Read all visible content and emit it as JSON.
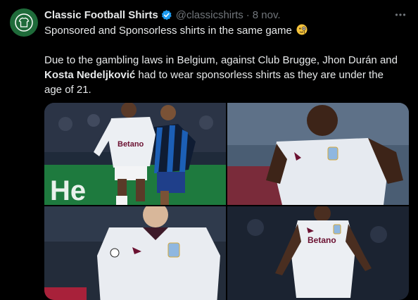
{
  "tweet": {
    "author_name": "Classic Football Shirts",
    "handle": "@classicshirts",
    "separator": "·",
    "date": "8 nov.",
    "text_line1": "Sponsored and Sponsorless shirts in the same game",
    "emoji": "face-with-monocle-emoji",
    "text_line2": "Due to the gambling laws in Belgium, against Club Brugge, Jhon Durán and",
    "text_line3_bold": "Kosta Nedeljković",
    "text_line3_rest": " had to wear sponsorless shirts as they are under the",
    "text_line4": "age of 21."
  },
  "media": {
    "photos": [
      {
        "alt": "player-sponsored-shirt-with-opponent",
        "sponsor": "Betano"
      },
      {
        "alt": "player-sponsorless-shirt",
        "sponsor": ""
      },
      {
        "alt": "player-sponsorless-shirt-2",
        "sponsor": ""
      },
      {
        "alt": "player-sponsored-shirt-2",
        "sponsor": "Betano"
      }
    ],
    "banner_text": "He"
  },
  "colors": {
    "background": "#000000",
    "text": "#e7e9ea",
    "muted": "#71767b",
    "verified": "#1d9bf0",
    "avatar": "#1f6b3a"
  },
  "icons": {
    "verified": "verified-badge-icon",
    "more": "more-options-icon",
    "avatar": "shirt-logo-icon"
  }
}
